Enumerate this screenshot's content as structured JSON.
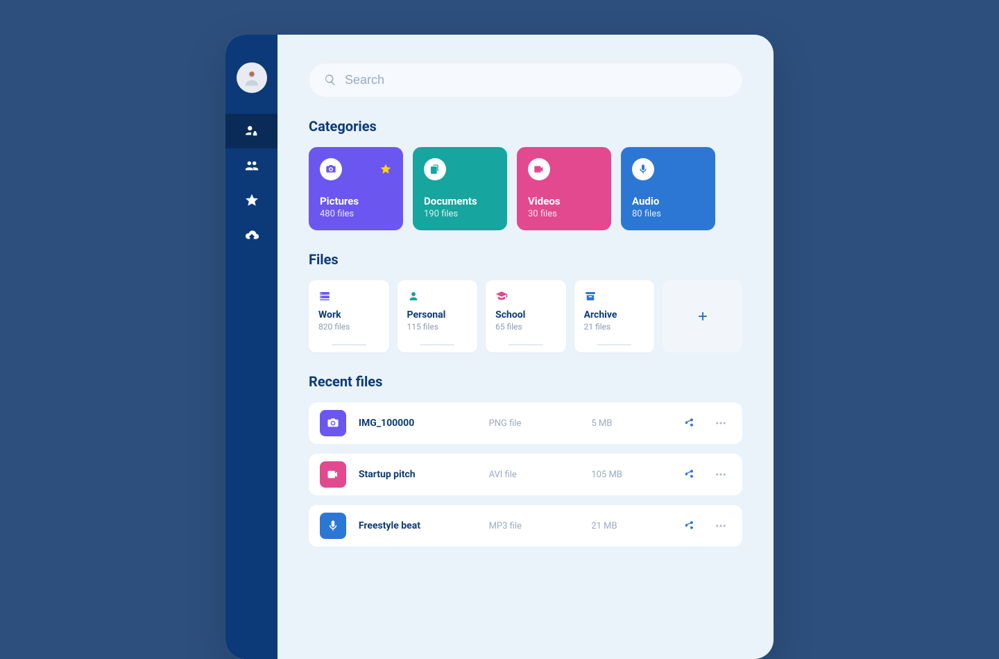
{
  "search": {
    "placeholder": "Search"
  },
  "sections": {
    "categories": "Categories",
    "files": "Files",
    "recent": "Recent files"
  },
  "categories": [
    {
      "name": "Pictures",
      "count": "480 files",
      "color": "#6b57ef",
      "icon": "camera",
      "starred": true
    },
    {
      "name": "Documents",
      "count": "190 files",
      "color": "#16a59f",
      "icon": "copy"
    },
    {
      "name": "Videos",
      "count": "30 files",
      "color": "#e2498e",
      "icon": "video"
    },
    {
      "name": "Audio",
      "count": "80 files",
      "color": "#2d77d4",
      "icon": "mic"
    }
  ],
  "folders": [
    {
      "name": "Work",
      "count": "820 files",
      "icon": "server",
      "icon_color": "#6b57ef"
    },
    {
      "name": "Personal",
      "count": "115 files",
      "icon": "user",
      "icon_color": "#16a59f"
    },
    {
      "name": "School",
      "count": "65 files",
      "icon": "grad",
      "icon_color": "#e2498e"
    },
    {
      "name": "Archive",
      "count": "21 files",
      "icon": "archive",
      "icon_color": "#2d77d4"
    }
  ],
  "recent": [
    {
      "name": "IMG_100000",
      "type": "PNG file",
      "size": "5 MB",
      "icon": "camera",
      "color": "#6b57ef"
    },
    {
      "name": "Startup pitch",
      "type": "AVI file",
      "size": "105 MB",
      "icon": "video",
      "color": "#e2498e"
    },
    {
      "name": "Freestyle beat",
      "type": "MP3 file",
      "size": "21 MB",
      "icon": "mic",
      "color": "#2d77d4"
    }
  ]
}
